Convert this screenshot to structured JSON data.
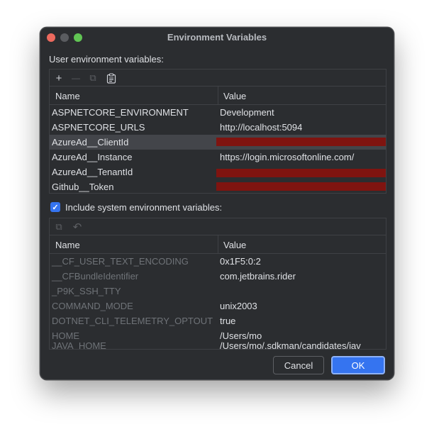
{
  "window": {
    "title": "Environment Variables"
  },
  "user_section": {
    "label": "User environment variables:",
    "toolbar": {
      "add_glyph": "+",
      "remove_glyph": "—",
      "copy_glyph": "⧉",
      "paste_glyph": "📋"
    },
    "columns": {
      "name": "Name",
      "value": "Value"
    },
    "rows": [
      {
        "name": "ASPNETCORE_ENVIRONMENT",
        "value": "Development",
        "redacted": false
      },
      {
        "name": "ASPNETCORE_URLS",
        "value": "http://localhost:5094",
        "redacted": false
      },
      {
        "name": "AzureAd__ClientId",
        "value": "",
        "redacted": true
      },
      {
        "name": "AzureAd__Instance",
        "value": "https://login.microsoftonline.com/",
        "redacted": false
      },
      {
        "name": "AzureAd__TenantId",
        "value": "",
        "redacted": true
      },
      {
        "name": "Github__Token",
        "value": "",
        "redacted": true
      }
    ]
  },
  "include_system": {
    "label": "Include system environment variables:",
    "checked": true,
    "check_glyph": "✓"
  },
  "system_section": {
    "toolbar": {
      "copy_glyph": "⧉",
      "undo_glyph": "↶"
    },
    "columns": {
      "name": "Name",
      "value": "Value"
    },
    "rows": [
      {
        "name": "__CF_USER_TEXT_ENCODING",
        "value": "0x1F5:0:2"
      },
      {
        "name": "__CFBundleIdentifier",
        "value": "com.jetbrains.rider"
      },
      {
        "name": "_P9K_SSH_TTY",
        "value": ""
      },
      {
        "name": "COMMAND_MODE",
        "value": "unix2003"
      },
      {
        "name": "DOTNET_CLI_TELEMETRY_OPTOUT",
        "value": "true"
      },
      {
        "name": "HOME",
        "value": "/Users/mo"
      },
      {
        "name": "JAVA_HOME",
        "value": "/Users/mo/.sdkman/candidates/jav"
      }
    ]
  },
  "buttons": {
    "cancel": "Cancel",
    "ok": "OK"
  },
  "colors": {
    "accent": "#3574f0",
    "redaction": "#7f1410",
    "background": "#2b2d30"
  }
}
